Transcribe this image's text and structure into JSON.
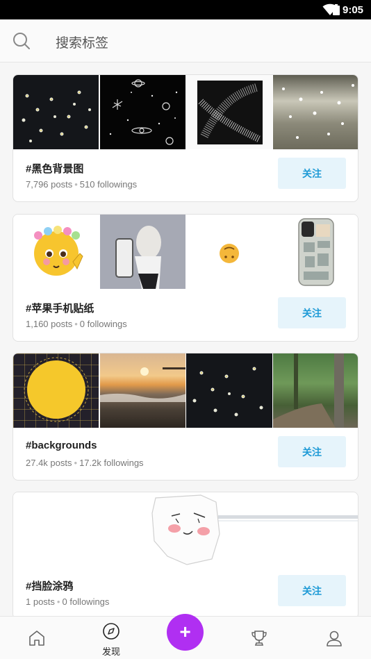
{
  "status_bar": {
    "time": "9:05"
  },
  "search": {
    "placeholder": "搜索标签"
  },
  "cards": [
    {
      "tag": "#黑色背景图",
      "posts": "7,796 posts",
      "followings": "510 followings",
      "follow_label": "关注",
      "thumbs": [
        "dark-daisies",
        "space-doodles",
        "ribbon-texture",
        "sparkle-water"
      ]
    },
    {
      "tag": "#苹果手机贴纸",
      "posts": "1,160 posts",
      "followings": "0 followings",
      "follow_label": "关注",
      "thumbs": [
        "flower-crown-emoji",
        "mirror-selfie",
        "upside-down-emoji",
        "phone-case"
      ]
    },
    {
      "tag": "#backgrounds",
      "posts": "27.4k posts",
      "followings": "17.2k followings",
      "follow_label": "关注",
      "thumbs": [
        "yellow-circle-grid",
        "sunset-beach",
        "dark-daisies",
        "forest-path"
      ]
    },
    {
      "tag": "#挡脸涂鸦",
      "posts": "1 posts",
      "followings": "0 followings",
      "follow_label": "关注",
      "thumbs": [
        "face-doodle"
      ]
    }
  ],
  "bottom_nav": {
    "items": [
      {
        "label": "",
        "icon": "home-icon"
      },
      {
        "label": "发现",
        "icon": "compass-icon"
      },
      {
        "label": "+",
        "icon": "plus-icon"
      },
      {
        "label": "",
        "icon": "trophy-icon"
      },
      {
        "label": "",
        "icon": "profile-icon"
      }
    ],
    "accent": "#b02ff2"
  },
  "colors": {
    "follow_bg": "#e6f4fb",
    "follow_text": "#1e9ad6"
  }
}
